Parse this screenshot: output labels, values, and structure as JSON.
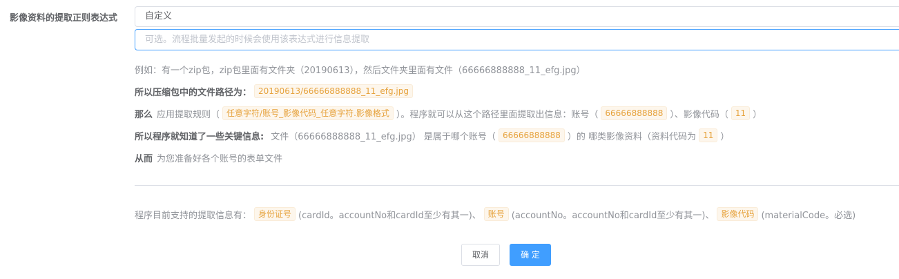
{
  "form": {
    "label": "影像资料的提取正则表达式",
    "select_value": "自定义",
    "input_placeholder": "可选。流程批量发起的时候会使用该表达式进行信息提取"
  },
  "help": {
    "line1_text": "例如：有一个zip包，zip包里面有文件夹（20190613），然后文件夹里面有文件（66666888888_11_efg.jpg）",
    "line2_bold": "所以压缩包中的文件路径为：",
    "line2_tag": "20190613/66666888888_11_efg.jpg",
    "line3_bold": "那么",
    "line3_a": "应用提取规则（",
    "line3_tag1": "任意字符/账号_影像代码_任意字符.影像格式",
    "line3_b": "）。程序就可以从这个路径里面提取出信息：账号（",
    "line3_tag2": "66666888888",
    "line3_c": "）、影像代码（",
    "line3_tag3": "11",
    "line3_d": "）",
    "line4_bold": "所以程序就知道了一些关键信息:",
    "line4_a": "文件（66666888888_11_efg.jpg） 是属于哪个账号（",
    "line4_tag1": "66666888888",
    "line4_b": "）的 哪类影像资料（资料代码为",
    "line4_tag2": "11",
    "line4_c": "）",
    "line5_bold": "从而",
    "line5_a": "为您准备好各个账号的表单文件"
  },
  "support": {
    "prefix": "程序目前支持的提取信息有：",
    "tag1": "身份证号",
    "text1": "(cardId。accountNo和cardId至少有其一)、",
    "tag2": "账号",
    "text2": "(accountNo。accountNo和cardId至少有其一)、",
    "tag3": "影像代码",
    "text3": "(materialCode。必选)"
  },
  "buttons": {
    "cancel": "取消",
    "ok": "确 定"
  }
}
